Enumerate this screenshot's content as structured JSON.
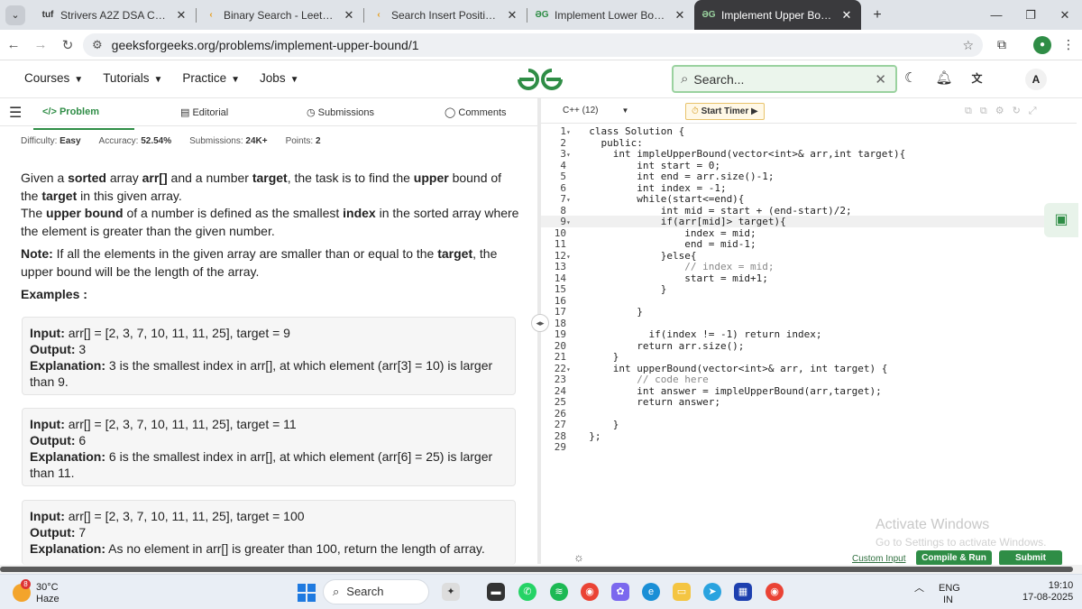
{
  "browser": {
    "tabs": [
      {
        "icon": "tuf",
        "label": "Strivers A2Z DSA Course/Sheet"
      },
      {
        "icon": "leetcode",
        "label": "Binary Search - LeetCode"
      },
      {
        "icon": "leetcode",
        "label": "Search Insert Position - LeetCode"
      },
      {
        "icon": "gfg",
        "label": "Implement Lower Bound | Practice"
      },
      {
        "icon": "gfg",
        "label": "Implement Upper Bound | Practice"
      }
    ],
    "url": "geeksforgeeks.org/problems/implement-upper-bound/1"
  },
  "header": {
    "nav": [
      "Courses",
      "Tutorials",
      "Practice",
      "Jobs"
    ],
    "search_placeholder": "Search...",
    "avatar": "A"
  },
  "problem_tabs": [
    "Problem",
    "Editorial",
    "Submissions",
    "Comments"
  ],
  "meta": {
    "difficulty_label": "Difficulty:",
    "difficulty": "Easy",
    "accuracy_label": "Accuracy:",
    "accuracy": "52.54%",
    "submissions_label": "Submissions:",
    "submissions": "24K+",
    "points_label": "Points:",
    "points": "2"
  },
  "problem": {
    "p1": [
      "Given a ",
      "sorted",
      " array ",
      "arr[]",
      " and a number ",
      "target",
      ", the task is to find the ",
      "upper",
      " bound of the ",
      "target",
      " in this given array."
    ],
    "p2": [
      "The ",
      "upper bound",
      " of a number is defined as the smallest ",
      "index",
      " in the sorted array where the element is greater than the given number."
    ],
    "p3": [
      "Note:",
      " If all the elements in the given array are smaller than or equal to the ",
      "target",
      ", the upper bound will be the length of the array."
    ],
    "examples_label": "Examples :"
  },
  "examples": [
    {
      "input": "arr[] = [2, 3, 7, 10, 11, 11, 25], target = 9",
      "output": "3",
      "explanation": "3 is the smallest index in arr[], at which element (arr[3] = 10) is larger than 9."
    },
    {
      "input": "arr[] = [2, 3, 7, 10, 11, 11, 25], target = 11",
      "output": "6",
      "explanation": "6 is the smallest index in arr[], at which element (arr[6] = 25) is larger than 11."
    },
    {
      "input": "arr[] = [2, 3, 7, 10, 11, 11, 25], target = 100",
      "output": "7",
      "explanation": "As no element in arr[] is greater than 100, return the length of array."
    }
  ],
  "labels": {
    "input": "Input:",
    "output": "Output:",
    "explanation": "Explanation:"
  },
  "editor": {
    "language": "C++ (12)",
    "timer": "Start Timer",
    "code": [
      "class Solution {",
      "  public:",
      "    int impleUpperBound(vector<int>& arr,int target){",
      "        int start = 0;",
      "        int end = arr.size()-1;",
      "        int index = -1;",
      "        while(start<=end){",
      "            int mid = start + (end-start)/2;",
      "            if(arr[mid]> target){",
      "                index = mid;",
      "                end = mid-1;",
      "            }else{",
      "                // index = mid;",
      "                start = mid+1;",
      "            }",
      "",
      "        }",
      "",
      "          if(index != -1) return index;",
      "        return arr.size();",
      "    }",
      "    int upperBound(vector<int>& arr, int target) {",
      "        // code here",
      "        int answer = impleUpperBound(arr,target);",
      "        return answer;",
      "",
      "    }",
      "};",
      ""
    ],
    "custom_input": "Custom Input",
    "compile": "Compile & Run",
    "submit": "Submit"
  },
  "watermark": {
    "title": "Activate Windows",
    "sub": "Go to Settings to activate Windows."
  },
  "taskbar": {
    "temp": "30°C",
    "weather": "Haze",
    "weather_badge": "8",
    "search": "Search",
    "lang1": "ENG",
    "lang2": "IN",
    "time": "19:10",
    "date": "17-08-2025"
  }
}
